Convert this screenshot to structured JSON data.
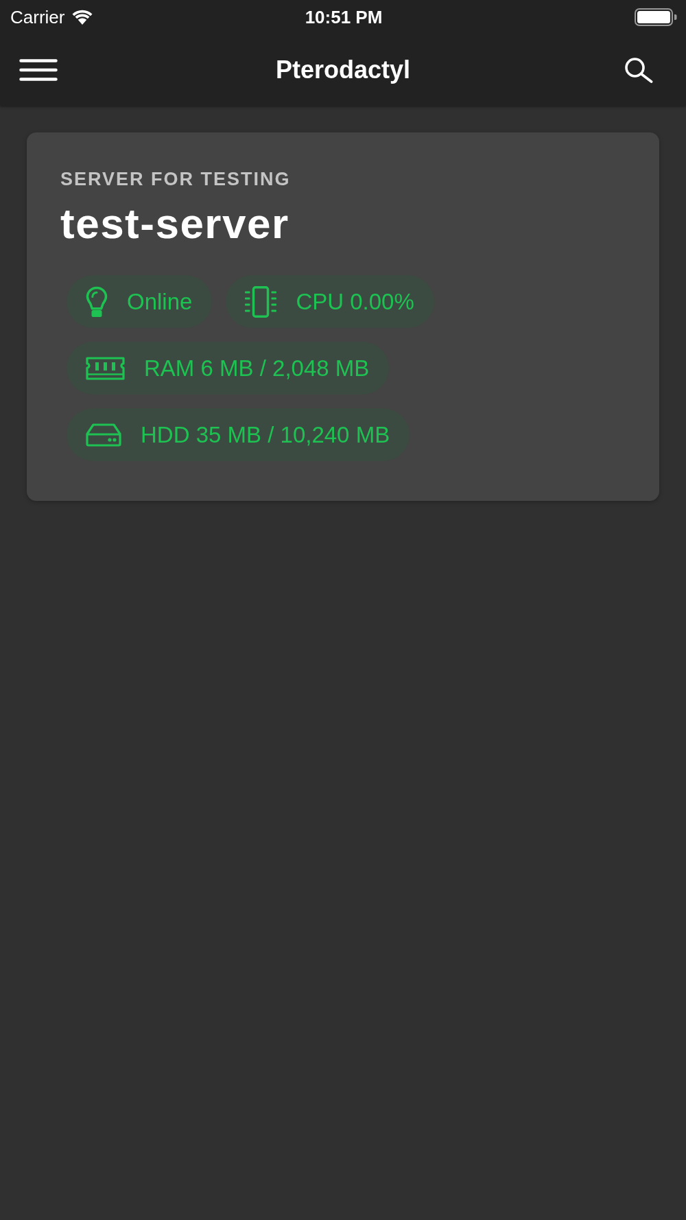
{
  "status_bar": {
    "carrier": "Carrier",
    "time": "10:51 PM"
  },
  "nav_bar": {
    "title": "Pterodactyl"
  },
  "servers": [
    {
      "description": "SERVER FOR TESTING",
      "name": "test-server",
      "stats": [
        {
          "kind": "status",
          "text": "Online"
        },
        {
          "kind": "cpu",
          "text": "CPU 0.00%"
        },
        {
          "kind": "ram",
          "text": "RAM 6 MB / 2,048 MB"
        },
        {
          "kind": "disk",
          "text": "HDD 35 MB / 10,240 MB"
        }
      ]
    }
  ]
}
